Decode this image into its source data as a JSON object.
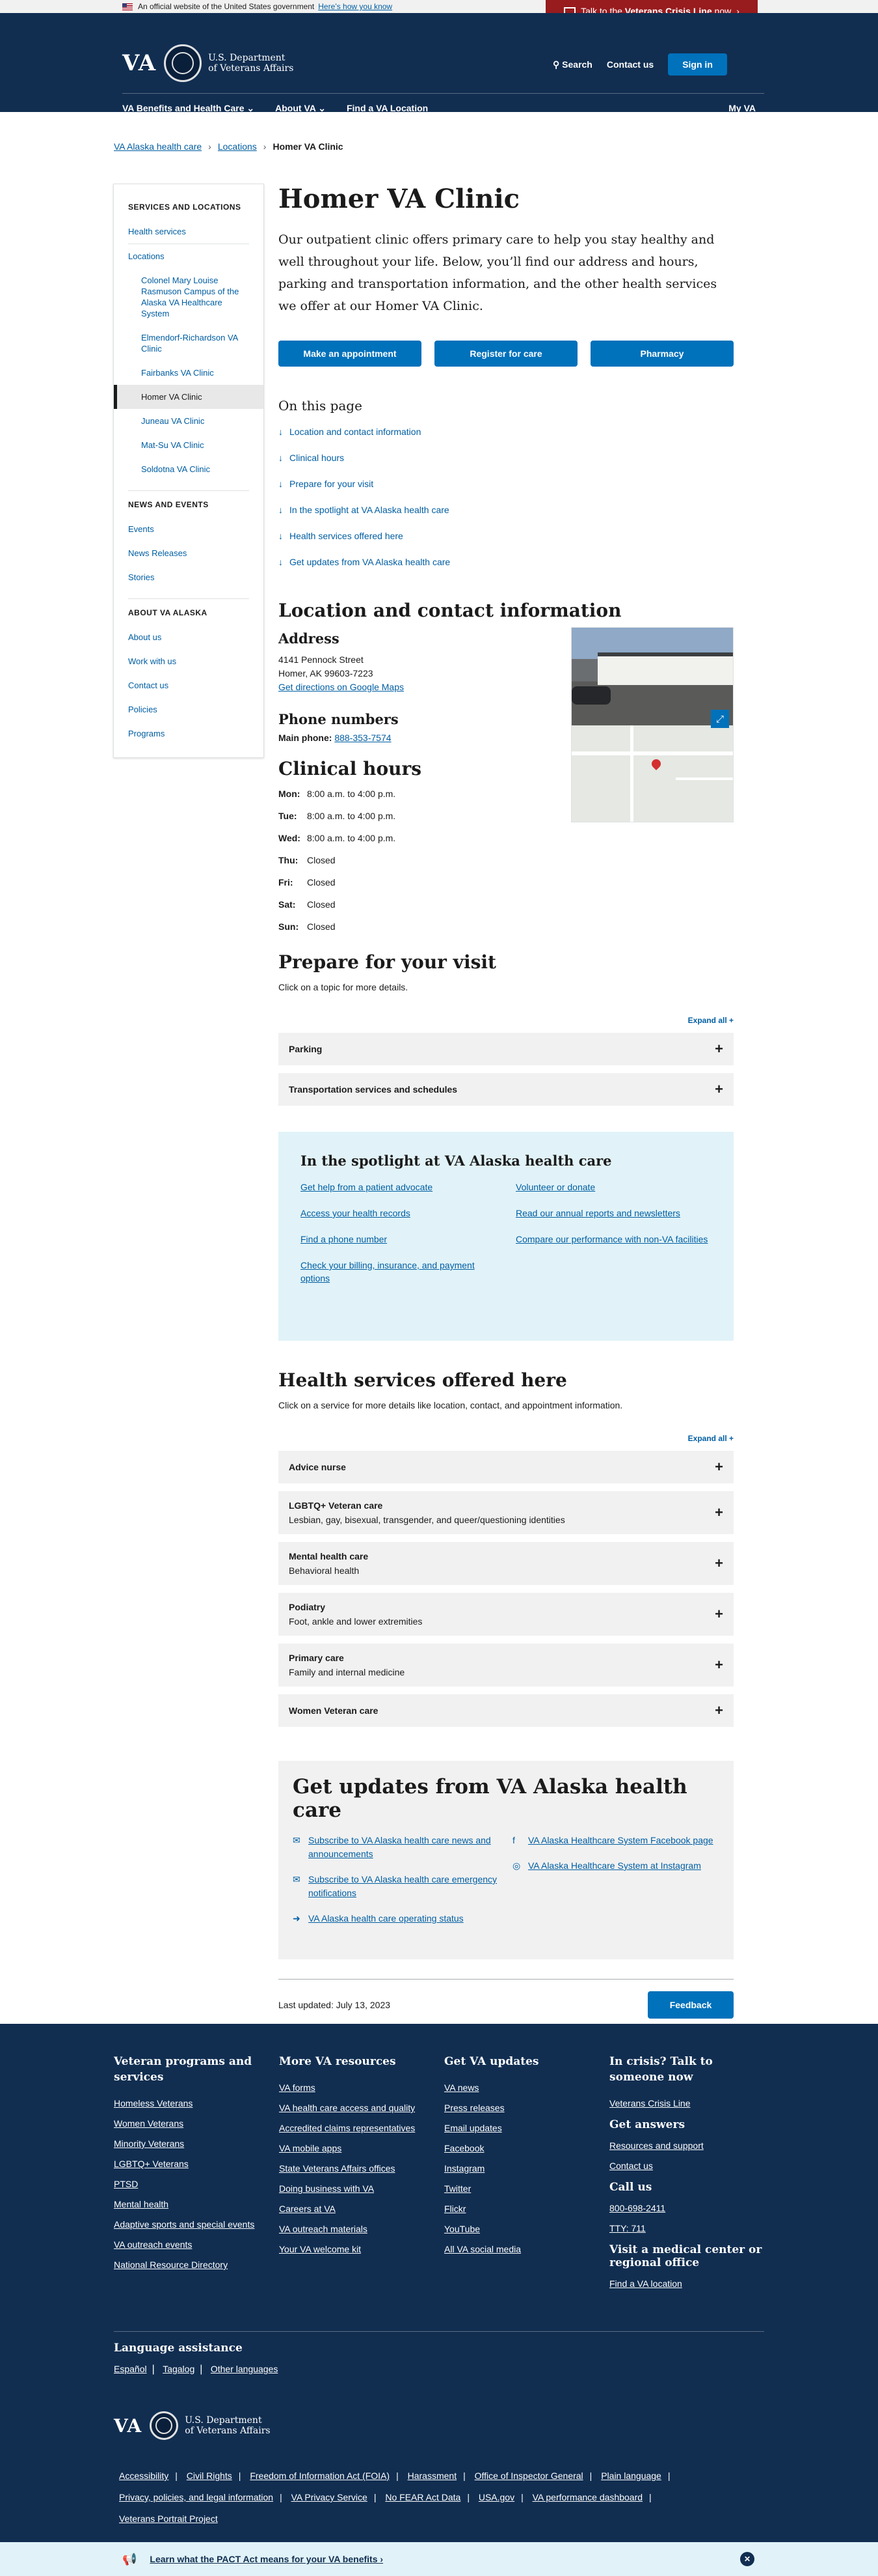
{
  "banner": {
    "official": "An official website of the United States government",
    "know": "Here’s how you know",
    "crisis_pre": "Talk to the ",
    "crisis_bold": "Veterans Crisis Line",
    "crisis_post": " now"
  },
  "header": {
    "logo": "VA",
    "dept_line1": "U.S. Department",
    "dept_line2": "of Veterans Affairs",
    "search": "Search",
    "contact": "Contact us",
    "signin": "Sign in"
  },
  "nav": {
    "items": [
      "VA Benefits and Health Care",
      "About VA",
      "Find a VA Location"
    ],
    "myva": "My VA"
  },
  "breadcrumbs": [
    "VA Alaska health care",
    "Locations",
    "Homer VA Clinic"
  ],
  "sidebar": {
    "section1_title": "SERVICES AND LOCATIONS",
    "health_services": "Health services",
    "locations": "Locations",
    "location_items": [
      "Colonel Mary Louise Rasmuson Campus of the Alaska VA Healthcare System",
      "Elmendorf-Richardson VA Clinic",
      "Fairbanks VA Clinic",
      "Homer VA Clinic",
      "Juneau VA Clinic",
      "Mat-Su VA Clinic",
      "Soldotna VA Clinic"
    ],
    "section2_title": "NEWS AND EVENTS",
    "news_items": [
      "Events",
      "News Releases",
      "Stories"
    ],
    "section3_title": "ABOUT VA ALASKA",
    "about_items": [
      "About us",
      "Work with us",
      "Contact us",
      "Policies",
      "Programs"
    ]
  },
  "main": {
    "title": "Homer VA Clinic",
    "lede": "Our outpatient clinic offers primary care to help you stay healthy and well throughout your life. Below, you’ll find our address and hours, parking and transportation information, and the other health services we offer at our Homer VA Clinic.",
    "cta": [
      "Make an appointment",
      "Register for care",
      "Pharmacy"
    ],
    "on_this_page_title": "On this page",
    "on_this_page": [
      "Location and contact information",
      "Clinical hours",
      "Prepare for your visit",
      "In the spotlight at VA Alaska health care",
      "Health services offered here",
      "Get updates from VA Alaska health care"
    ],
    "location_title": "Location and contact information",
    "address_title": "Address",
    "address_line1": "4141 Pennock Street",
    "address_line2": "Homer, AK 99603-7223",
    "directions": "Get directions on Google Maps",
    "phone_title": "Phone numbers",
    "phone_label": "Main phone:",
    "phone_number": "888-353-7574",
    "hours_title": "Clinical hours",
    "hours": [
      {
        "day": "Mon:",
        "time": "8:00 a.m. to 4:00 p.m."
      },
      {
        "day": "Tue:",
        "time": "8:00 a.m. to 4:00 p.m."
      },
      {
        "day": "Wed:",
        "time": "8:00 a.m. to 4:00 p.m."
      },
      {
        "day": "Thu:",
        "time": "Closed"
      },
      {
        "day": "Fri:",
        "time": "Closed"
      },
      {
        "day": "Sat:",
        "time": "Closed"
      },
      {
        "day": "Sun:",
        "time": "Closed"
      }
    ],
    "prepare_title": "Prepare for your visit",
    "prepare_sub": "Click on a topic for more details.",
    "expand_all": "Expand all +",
    "prepare_items": [
      "Parking",
      "Transportation services and schedules"
    ],
    "spotlight_title": "In the spotlight at VA Alaska health care",
    "spotlight_left": [
      "Get help from a patient advocate",
      "Access your health records",
      "Find a phone number",
      "Check your billing, insurance, and payment options"
    ],
    "spotlight_right": [
      "Volunteer or donate",
      "Read our annual reports and newsletters",
      "Compare our performance with non-VA facilities"
    ],
    "services_title": "Health services offered here",
    "services_sub": "Click on a service for more details like location, contact, and appointment information.",
    "services": [
      {
        "name": "Advice nurse",
        "desc": ""
      },
      {
        "name": "LGBTQ+ Veteran care",
        "desc": "Lesbian, gay, bisexual, transgender, and queer/questioning identities"
      },
      {
        "name": "Mental health care",
        "desc": "Behavioral health"
      },
      {
        "name": "Podiatry",
        "desc": "Foot, ankle and lower extremities"
      },
      {
        "name": "Primary care",
        "desc": "Family and internal medicine"
      },
      {
        "name": "Women Veteran care",
        "desc": ""
      }
    ],
    "updates_title": "Get updates from VA Alaska health care",
    "updates_left": [
      "Subscribe to VA Alaska health care news and announcements",
      "Subscribe to VA Alaska health care emergency notifications",
      "VA Alaska health care operating status"
    ],
    "updates_right": [
      "VA Alaska Healthcare System Facebook page",
      "VA Alaska Healthcare System at Instagram"
    ],
    "last_updated": "Last updated: July 13, 2023",
    "feedback": "Feedback"
  },
  "footer": {
    "col1_title": "Veteran programs and services",
    "col1": [
      "Homeless Veterans",
      "Women Veterans",
      "Minority Veterans",
      "LGBTQ+ Veterans",
      "PTSD",
      "Mental health",
      "Adaptive sports and special events",
      "VA outreach events",
      "National Resource Directory"
    ],
    "col2_title": "More VA resources",
    "col2": [
      "VA forms",
      "VA health care access and quality",
      "Accredited claims representatives",
      "VA mobile apps",
      "State Veterans Affairs offices",
      "Doing business with VA",
      "Careers at VA",
      "VA outreach materials",
      "Your VA welcome kit"
    ],
    "col3_title": "Get VA updates",
    "col3": [
      "VA news",
      "Press releases",
      "Email updates",
      "Facebook",
      "Instagram",
      "Twitter",
      "Flickr",
      "YouTube",
      "All VA social media"
    ],
    "col4_title": "In crisis? Talk to someone now",
    "col4_crisis": "Veterans Crisis Line",
    "answers_title": "Get answers",
    "answers": [
      "Resources and support",
      "Contact us"
    ],
    "call_title": "Call us",
    "call": [
      "800-698-2411",
      "TTY: 711"
    ],
    "visit_title": "Visit a medical center or regional office",
    "visit": "Find a VA location",
    "lang_title": "Language assistance",
    "langs": [
      "Español",
      "Tagalog",
      "Other languages"
    ],
    "logo": "VA",
    "dept_line1": "U.S. Department",
    "dept_line2": "of Veterans Affairs",
    "links": [
      "Accessibility",
      "Civil Rights",
      "Freedom of Information Act (FOIA)",
      "Harassment",
      "Office of Inspector General",
      "Plain language",
      "Privacy, policies, and legal information",
      "VA Privacy Service",
      "No FEAR Act Data",
      "USA.gov",
      "VA performance dashboard",
      "Veterans Portrait Project"
    ]
  },
  "pact": {
    "text": "Learn what the PACT Act means for your VA benefits ›"
  }
}
